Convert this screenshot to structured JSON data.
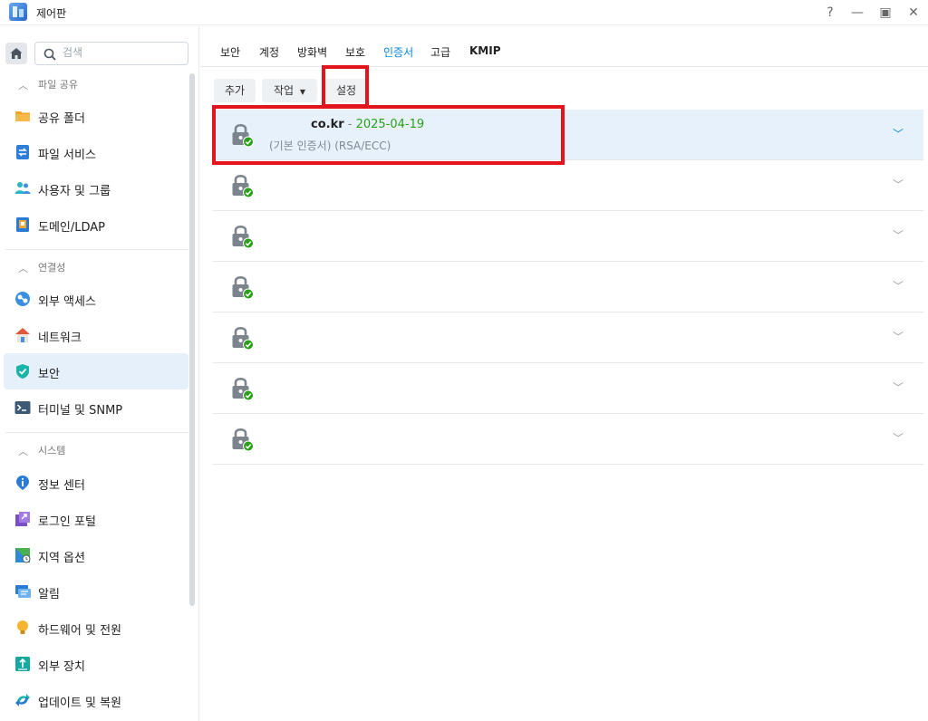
{
  "window": {
    "title": "제어판",
    "help_label": "?",
    "minimize_label": "—",
    "maximize_label": "▣",
    "close_label": "✕"
  },
  "sidebar": {
    "search_placeholder": "검색",
    "sections": [
      {
        "label": "파일 공유",
        "items": [
          "공유 폴더",
          "파일 서비스",
          "사용자 및 그룹",
          "도메인/LDAP"
        ]
      },
      {
        "label": "연결성",
        "items": [
          "외부 액세스",
          "네트워크",
          "보안",
          "터미널 및 SNMP"
        ]
      },
      {
        "label": "시스템",
        "items": [
          "정보 센터",
          "로그인 포털",
          "지역 옵션",
          "알림",
          "하드웨어 및 전원",
          "외부 장치",
          "업데이트 및 복원"
        ]
      }
    ],
    "active_item": "보안"
  },
  "tabs": [
    "보안",
    "계정",
    "방화벽",
    "보호",
    "인증서",
    "고급",
    "KMIP"
  ],
  "active_tab": "인증서",
  "toolbar": {
    "add_label": "추가",
    "action_label": "작업",
    "settings_label": "설정"
  },
  "certificates": [
    {
      "domain": "co.kr",
      "separator": " - ",
      "expiry": "2025-04-19",
      "description": "(기본 인증서) (RSA/ECC)",
      "selected": true
    },
    {
      "domain": "",
      "expiry": "",
      "description": ""
    },
    {
      "domain": "",
      "expiry": "",
      "description": ""
    },
    {
      "domain": "",
      "expiry": "",
      "description": ""
    },
    {
      "domain": "",
      "expiry": "",
      "description": ""
    },
    {
      "domain": "",
      "expiry": "",
      "description": ""
    },
    {
      "domain": "",
      "expiry": "",
      "description": ""
    }
  ],
  "colors": {
    "accent": "#0086e5",
    "highlight": "#e3141b",
    "valid": "#2aa01a"
  }
}
